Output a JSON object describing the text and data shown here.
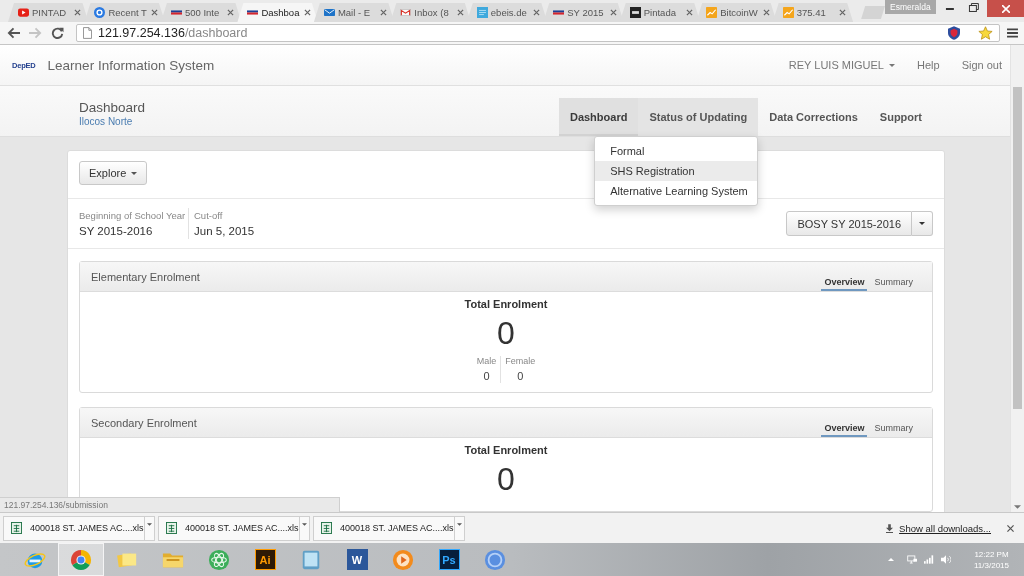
{
  "browser": {
    "tabs": [
      {
        "kind": "play",
        "title": "PINTAD",
        "selected": false
      },
      {
        "kind": "ring",
        "title": "Recent T",
        "selected": false
      },
      {
        "kind": "flag",
        "title": "500 Inte",
        "selected": false
      },
      {
        "kind": "flag",
        "title": "Dashboa",
        "selected": true
      },
      {
        "kind": "envelope",
        "title": "Mail - E",
        "selected": false
      },
      {
        "kind": "letter",
        "title": "Inbox (8",
        "selected": false
      },
      {
        "kind": "tile",
        "title": "ebeis.de",
        "selected": false
      },
      {
        "kind": "flag",
        "title": "SY 2015",
        "selected": false
      },
      {
        "kind": "square",
        "title": "Pintada",
        "selected": false
      },
      {
        "kind": "chart",
        "title": "BitcoinW",
        "selected": false
      },
      {
        "kind": "chart",
        "title": "375.41",
        "selected": false
      }
    ],
    "profile": "Esmeralda",
    "address": {
      "host": "121.97.254.136",
      "path": "/dashboard"
    }
  },
  "app": {
    "logo": "DepED",
    "title": "Learner Information System",
    "user": "REY LUIS MIGUEL",
    "links": [
      "Help",
      "Sign out"
    ]
  },
  "page_header": {
    "title": "Dashboard",
    "subtitle": "Ilocos Norte",
    "nav": [
      {
        "label": "Dashboard",
        "selected": true,
        "expanded": false
      },
      {
        "label": "Status of Updating",
        "selected": false,
        "expanded": true,
        "menu": [
          {
            "label": "Formal",
            "highlighted": false
          },
          {
            "label": "SHS Registration",
            "highlighted": true
          },
          {
            "label": "Alternative Learning System",
            "highlighted": false
          }
        ]
      },
      {
        "label": "Data Corrections",
        "selected": false,
        "expanded": false
      },
      {
        "label": "Support",
        "selected": false,
        "expanded": false
      }
    ]
  },
  "explore_button": "Explore",
  "school_year": {
    "fields": [
      {
        "label": "Beginning of School Year",
        "value": "SY 2015-2016"
      },
      {
        "label": "Cut-off",
        "value": "Jun 5, 2015"
      }
    ],
    "period_button": "BOSY SY 2015-2016"
  },
  "panels": [
    {
      "title": "Elementary Enrolment",
      "tabs": [
        {
          "label": "Overview",
          "selected": true
        },
        {
          "label": "Summary",
          "selected": false
        }
      ],
      "total_label": "Total Enrolment",
      "total": "0",
      "breakdown": [
        {
          "label": "Male",
          "value": "0"
        },
        {
          "label": "Female",
          "value": "0"
        }
      ]
    },
    {
      "title": "Secondary Enrolment",
      "tabs": [
        {
          "label": "Overview",
          "selected": true
        },
        {
          "label": "Summary",
          "selected": false
        }
      ],
      "total_label": "Total Enrolment",
      "total": "0"
    }
  ],
  "status_url": "121.97.254.136/submission",
  "downloads": {
    "items": [
      {
        "name": "400018 ST. JAMES AC....xls"
      },
      {
        "name": "400018 ST. JAMES AC....xls"
      },
      {
        "name": "400018 ST. JAMES AC....xls"
      }
    ],
    "show_all": "Show all downloads..."
  },
  "taskbar": {
    "apps": [
      {
        "kind": "browser-e",
        "selected": false
      },
      {
        "kind": "browser-disc",
        "selected": true
      },
      {
        "kind": "notes",
        "selected": false
      },
      {
        "kind": "folder",
        "selected": false
      },
      {
        "kind": "atom",
        "selected": false
      },
      {
        "kind": "tile-ai",
        "label": "Ai",
        "selected": false
      },
      {
        "kind": "tablet",
        "selected": false
      },
      {
        "kind": "tile-w",
        "label": "W",
        "selected": false
      },
      {
        "kind": "player",
        "selected": false
      },
      {
        "kind": "tile-ps",
        "label": "Ps",
        "selected": false
      },
      {
        "kind": "ring",
        "selected": false
      }
    ],
    "clock": {
      "time": "12:22 PM",
      "date": "11/3/2015"
    }
  }
}
